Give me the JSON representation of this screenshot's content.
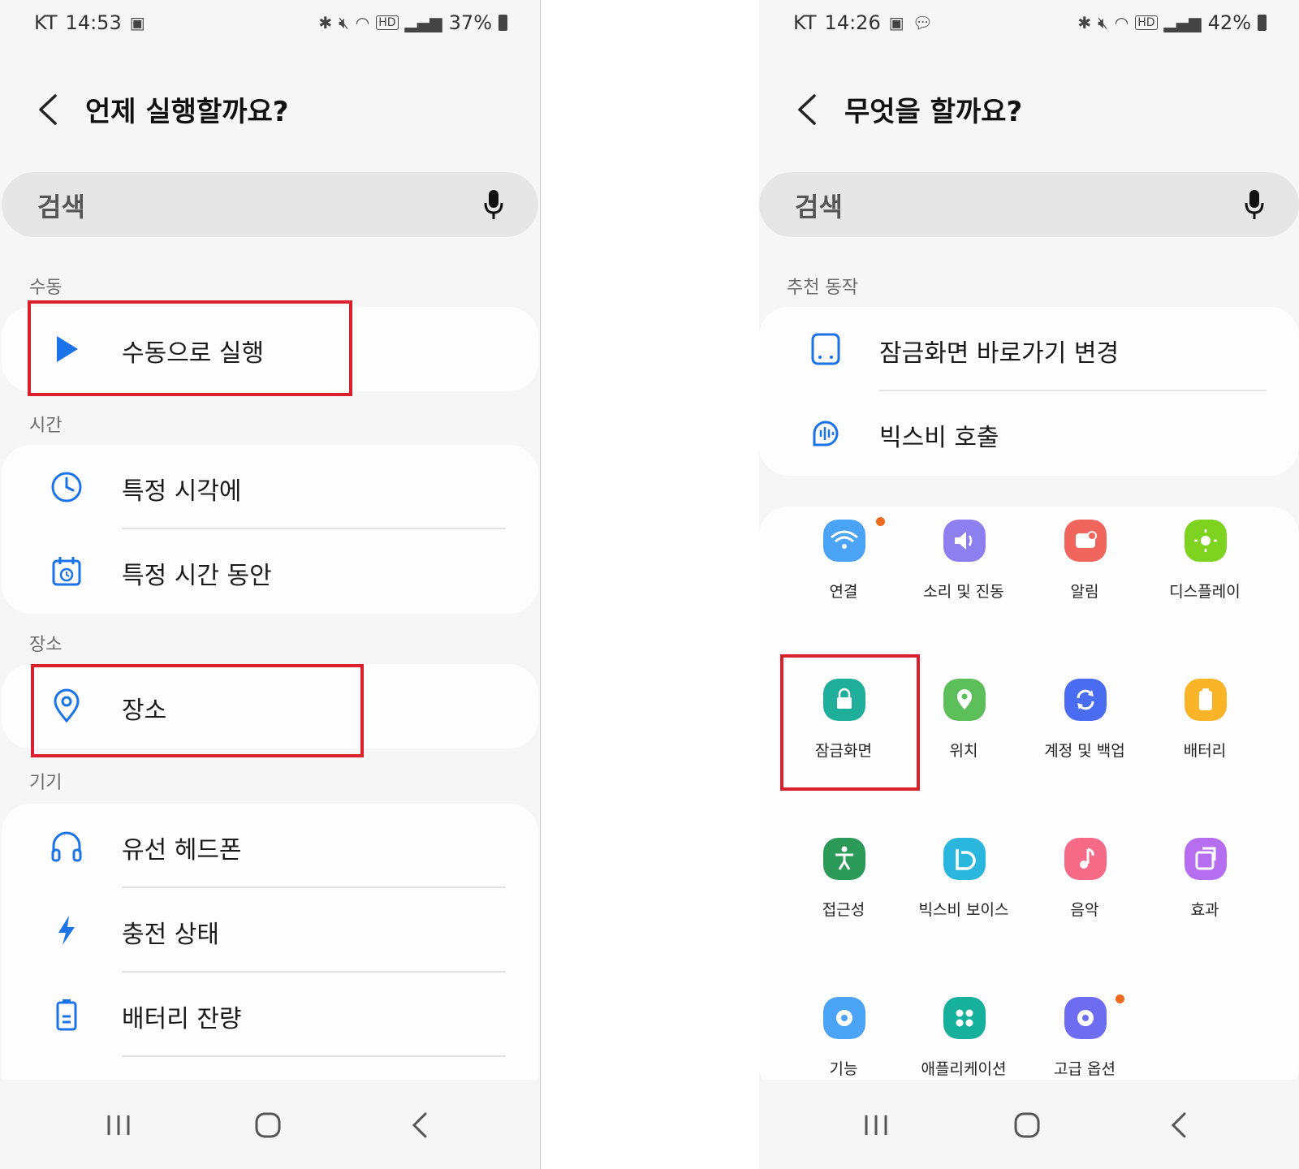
{
  "left": {
    "status": {
      "carrier": "KT",
      "time": "14:53",
      "battery": "37%"
    },
    "title": "언제 실행할까요?",
    "search_placeholder": "검색",
    "sections": {
      "manual": "수동",
      "time": "시간",
      "place": "장소",
      "device": "기기"
    },
    "items": {
      "manual_run": "수동으로 실행",
      "specific_time": "특정 시각에",
      "time_period": "특정 시간 동안",
      "place": "장소",
      "wired_headphones": "유선 헤드폰",
      "charging": "충전 상태",
      "battery_level": "배터리 잔량"
    }
  },
  "right": {
    "status": {
      "carrier": "KT",
      "time": "14:26",
      "battery": "42%"
    },
    "title": "무엇을 할까요?",
    "search_placeholder": "검색",
    "recommended_label": "추천 동작",
    "recommended": [
      "잠금화면 바로가기 변경",
      "빅스비 호출"
    ],
    "grid": [
      {
        "label": "연결",
        "color": "#4aa3f5",
        "icon": "wifi-icon"
      },
      {
        "label": "소리 및 진동",
        "color": "#8d7ff0",
        "icon": "volume-icon"
      },
      {
        "label": "알림",
        "color": "#f0665c",
        "icon": "notification-icon"
      },
      {
        "label": "디스플레이",
        "color": "#7ed321",
        "icon": "sun-icon"
      },
      {
        "label": "잠금화면",
        "color": "#1fae9a",
        "icon": "lock-icon"
      },
      {
        "label": "위치",
        "color": "#5dbf5a",
        "icon": "location-icon"
      },
      {
        "label": "계정 및 백업",
        "color": "#4a6cf0",
        "icon": "sync-icon"
      },
      {
        "label": "배터리",
        "color": "#f9b428",
        "icon": "battery-icon"
      },
      {
        "label": "접근성",
        "color": "#2b9a58",
        "icon": "accessibility-icon"
      },
      {
        "label": "빅스비 보이스",
        "color": "#2bb7dd",
        "icon": "bixby-icon"
      },
      {
        "label": "음악",
        "color": "#f56b87",
        "icon": "music-icon"
      },
      {
        "label": "효과",
        "color": "#b56ef0",
        "icon": "effect-icon"
      },
      {
        "label": "기능",
        "color": "#4aa3f5",
        "icon": "gear-icon"
      },
      {
        "label": "애플리케이션",
        "color": "#17b09a",
        "icon": "apps-icon"
      },
      {
        "label": "고급 옵션",
        "color": "#6e6cf0",
        "icon": "advanced-gear-icon"
      }
    ]
  }
}
